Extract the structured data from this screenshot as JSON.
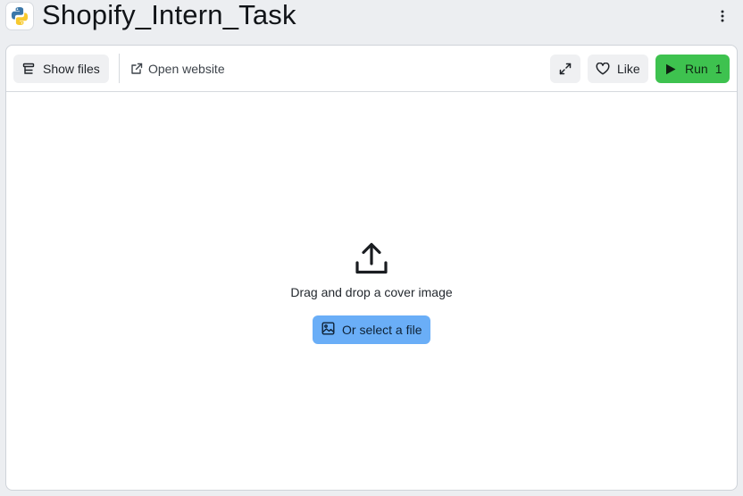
{
  "header": {
    "title": "Shopify_Intern_Task",
    "app_icon": "python-logo-icon",
    "menu_icon": "kebab-menu-icon"
  },
  "toolbar": {
    "show_files_label": "Show files",
    "open_website_label": "Open website",
    "like_label": "Like",
    "run_label": "Run",
    "run_count": "1",
    "run_color": "#3ec24f"
  },
  "dropzone": {
    "prompt": "Drag and drop a cover image",
    "select_label": "Or select a file",
    "select_color": "#6aaef7"
  }
}
